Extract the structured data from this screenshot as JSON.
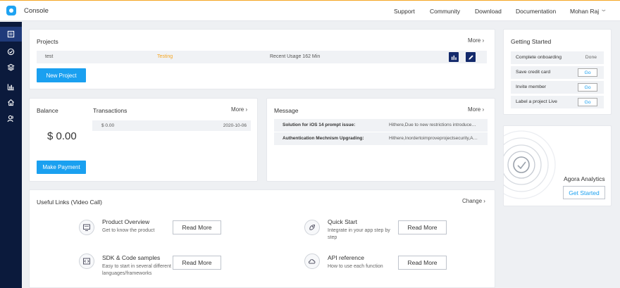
{
  "topbar": {
    "brand": "Console",
    "nav": [
      "Support",
      "Community",
      "Download",
      "Documentation",
      "Mohan Raj"
    ]
  },
  "sidebar": {
    "icons": [
      "projects-icon",
      "usage-icon",
      "layers-icon",
      "analytics-icon",
      "home-icon",
      "members-icon"
    ]
  },
  "projects": {
    "title": "Projects",
    "more": "More",
    "row": {
      "name": "test",
      "status": "Testing",
      "usage": "Recent Usage 162 Min"
    },
    "new_button": "New Project"
  },
  "balance": {
    "title": "Balance",
    "amount": "$ 0.00",
    "pay_button": "Make Payment"
  },
  "transactions": {
    "title": "Transactions",
    "more": "More",
    "rows": [
      {
        "amount": "$ 0.00",
        "date": "2020-10-06"
      }
    ]
  },
  "message": {
    "title": "Message",
    "more": "More",
    "rows": [
      {
        "subject": "Solution for iOS 14 prompt issue:",
        "preview": "Hithere,Due to new restrictions introduce…"
      },
      {
        "subject": "Authentication Mechnism Upgrading:",
        "preview": "Hithere,Inordertoimproveprojectsecurity,A…"
      }
    ]
  },
  "getting_started": {
    "title": "Getting Started",
    "rows": [
      {
        "label": "Complete onboarding",
        "value": "Done"
      },
      {
        "label": "Save credit card",
        "value": "Go"
      },
      {
        "label": "Invite member",
        "value": "Go"
      },
      {
        "label": "Label a project Live",
        "value": "Go"
      }
    ]
  },
  "analytics": {
    "title": "Agora Analytics",
    "button": "Get Started"
  },
  "useful_links": {
    "title": "Useful Links (Video Call)",
    "change": "Change",
    "items": [
      {
        "title": "Product Overview",
        "desc": "Get to know the product",
        "button": "Read More"
      },
      {
        "title": "Quick Start",
        "desc": "Integrate in your app step by step",
        "button": "Read More"
      },
      {
        "title": "SDK & Code samples",
        "desc": "Easy to start in several different languages/frameworks",
        "button": "Read More"
      },
      {
        "title": "API reference",
        "desc": "How to use each function",
        "button": "Read More"
      }
    ]
  },
  "colors": {
    "accent": "#1aa0f0",
    "sidebar": "#0b1a3c",
    "status_testing": "#f5a623",
    "top_border": "#f5a623"
  }
}
